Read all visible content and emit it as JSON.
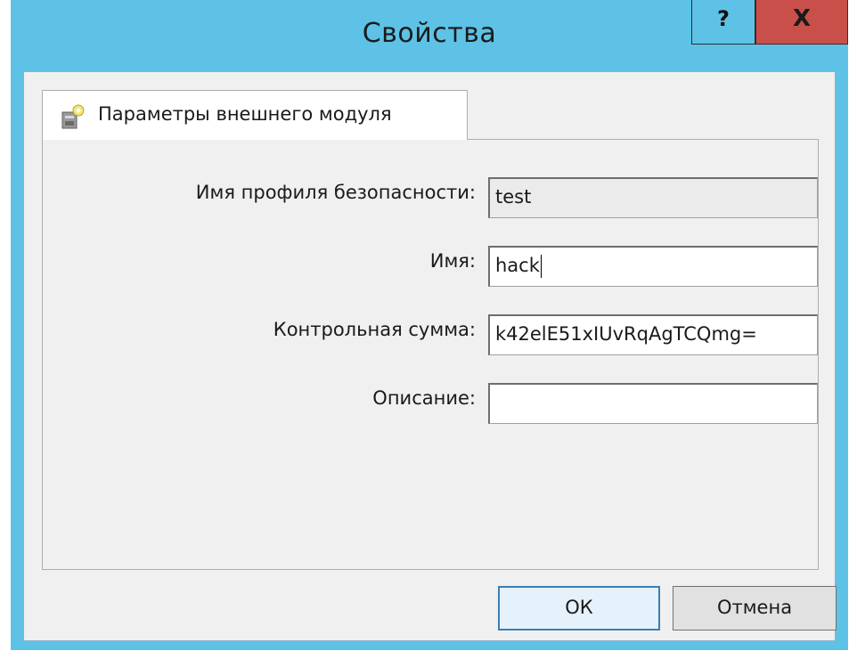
{
  "window": {
    "title": "Свойства",
    "help_label": "?",
    "close_label": "X"
  },
  "tab": {
    "label": "Параметры внешнего модуля",
    "icon": "module-icon"
  },
  "fields": {
    "profile_name": {
      "label": "Имя профиля безопасности:",
      "value": "test",
      "readonly": true
    },
    "name": {
      "label": "Имя:",
      "value": "hack"
    },
    "checksum": {
      "label": "Контрольная сумма:",
      "value": "k42elE51xIUvRqAgTCQmg="
    },
    "description": {
      "label": "Описание:",
      "value": ""
    }
  },
  "buttons": {
    "ok": "ОК",
    "cancel": "Отмена"
  },
  "colors": {
    "titlebar": "#5ec2e6",
    "close": "#c9504a",
    "client": "#f0f0f0"
  }
}
